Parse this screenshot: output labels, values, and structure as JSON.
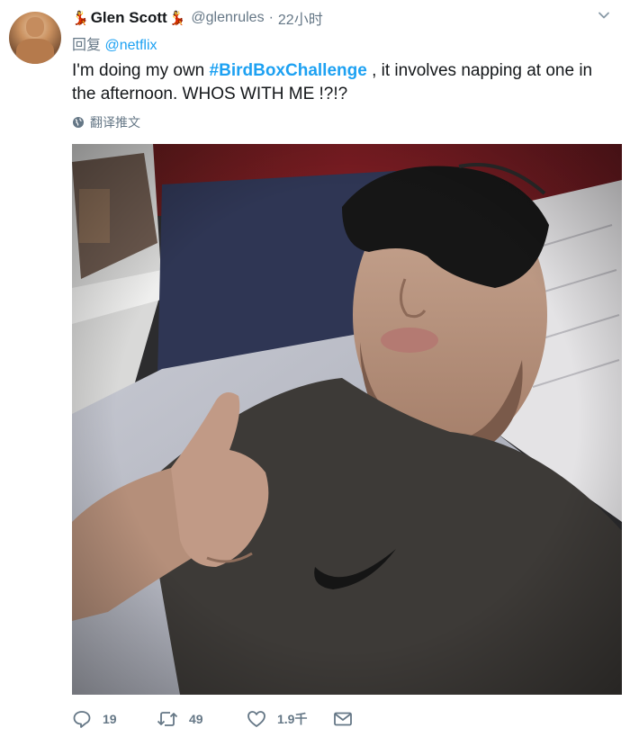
{
  "user": {
    "display_name": "Glen Scott",
    "handle": "@glenrules",
    "time": "22小时",
    "separator": "·",
    "avatar_icon": "profile-photo",
    "name_decoration_icon": "dancer-emoji"
  },
  "reply": {
    "prefix": "回复",
    "mention": "@netflix"
  },
  "tweet": {
    "text_before": "I'm doing my own ",
    "hashtag": "#BirdBoxChallenge",
    "text_after": " , it involves napping at one in the afternoon. WHOS WITH ME !?!?"
  },
  "translate": {
    "label": "翻译推文",
    "icon": "globe-icon"
  },
  "actions": {
    "replies": "19",
    "retweets": "49",
    "likes": "1.9千",
    "reply_icon": "reply-icon",
    "retweet_icon": "retweet-icon",
    "like_icon": "heart-icon",
    "dm_icon": "envelope-icon"
  },
  "colors": {
    "link": "#1da1f2",
    "secondary": "#657786",
    "text": "#14171a"
  }
}
